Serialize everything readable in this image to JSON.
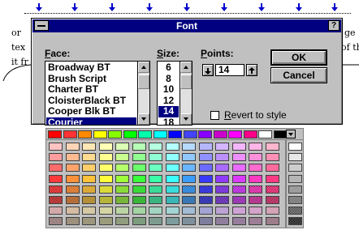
{
  "document": {
    "line1_left": "or",
    "line1_right": "ge",
    "line2_left": "tex",
    "line2_right": "of th",
    "line3_left": "it fr"
  },
  "dialog": {
    "title": "Font",
    "help_label": "?",
    "face": {
      "label_u": "F",
      "label_rest": "ace:",
      "items": [
        "Broadway BT",
        "Brush Script",
        "Charter BT",
        "CloisterBlack BT",
        "Cooper Blk BT",
        "Courier"
      ],
      "selected": "Courier"
    },
    "size": {
      "label_u": "S",
      "label_rest": "ize:",
      "items": [
        "6",
        "8",
        "10",
        "12",
        "14",
        "18"
      ],
      "selected": "14"
    },
    "points": {
      "label_u": "P",
      "label_rest": "oints:",
      "value": "14"
    },
    "ok_label": "OK",
    "cancel_label": "Cancel",
    "revert": {
      "label_u": "R",
      "label_rest": "evert to style",
      "checked": false
    }
  },
  "palette": {
    "current_row": [
      "#ff0000",
      "#ff3333",
      "#ff8800",
      "#ffff00",
      "#88ff00",
      "#00ff00",
      "#00ffaa",
      "#00ffff",
      "#0000ff",
      "#4444ff",
      "#8800ff",
      "#cc00cc",
      "#ff00ff",
      "#ff0088",
      "#ffffff",
      "#000000"
    ],
    "rows": [
      [
        "#ffb0b0",
        "#ffc8a0",
        "#ffe0a0",
        "#ffffa0",
        "#d0ffa0",
        "#a0ffa0",
        "#a0ffd8",
        "#a0ffff",
        "#a0d0ff",
        "#a0a0ff",
        "#c8a0ff",
        "#f0a0ff",
        "#ffa0e0",
        "#ffa0c0"
      ],
      [
        "#ff8080",
        "#ffa870",
        "#ffd070",
        "#ffff70",
        "#b8ff70",
        "#70ff70",
        "#70ffc8",
        "#70ffff",
        "#70b8ff",
        "#7070ff",
        "#a870ff",
        "#e870ff",
        "#ff70d0",
        "#ff70a0"
      ],
      [
        "#ff4040",
        "#ff8840",
        "#ffc040",
        "#ffff40",
        "#a0ff40",
        "#40ff40",
        "#40ffb0",
        "#40ffff",
        "#40a0ff",
        "#4040ff",
        "#9040ff",
        "#e040ff",
        "#ff40c0",
        "#ff4080"
      ],
      [
        "#ff0000",
        "#ff7000",
        "#ffb000",
        "#ffff00",
        "#80ff00",
        "#00ff00",
        "#00ff90",
        "#00ffff",
        "#0080ff",
        "#0000ff",
        "#7000ff",
        "#d000ff",
        "#ff00b0",
        "#ff0060"
      ],
      [
        "#d00000",
        "#d05800",
        "#d09000",
        "#d0d000",
        "#68d000",
        "#00d000",
        "#00d078",
        "#00d0d0",
        "#0068d0",
        "#0000d0",
        "#5800d0",
        "#a800d0",
        "#d00090",
        "#d00050"
      ],
      [
        "#a00000",
        "#a04400",
        "#a07000",
        "#a0a000",
        "#50a000",
        "#00a000",
        "#00a05c",
        "#00a0a0",
        "#0050a0",
        "#0000a0",
        "#4400a0",
        "#8000a0",
        "#a00070",
        "#a0003c"
      ],
      [
        "#c89090",
        "#c8a888",
        "#c8b888",
        "#c8c888",
        "#a8c888",
        "#88c888",
        "#88c8b0",
        "#88c8c8",
        "#88a8c8",
        "#8888c8",
        "#a888c8",
        "#c088c8",
        "#c888b8",
        "#c888a0"
      ],
      [
        "#806060",
        "#807058",
        "#807858",
        "#808058",
        "#708058",
        "#588058",
        "#588070",
        "#588080",
        "#587080",
        "#585880",
        "#705880",
        "#785880",
        "#805878",
        "#805868"
      ]
    ],
    "grays": [
      "#ffffff",
      "#e0e0e0",
      "#c0c0c0",
      "#a0a0a0",
      "#808080",
      "#606060",
      "#404040",
      "#000000"
    ]
  }
}
